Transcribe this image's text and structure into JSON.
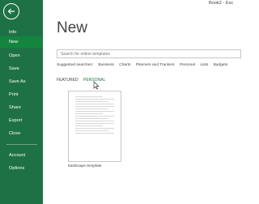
{
  "window": {
    "title": "Book2 - Exc"
  },
  "sidebar": {
    "items": [
      {
        "label": "Info"
      },
      {
        "label": "New"
      },
      {
        "label": "Open"
      },
      {
        "label": "Save"
      },
      {
        "label": "Save As"
      },
      {
        "label": "Print"
      },
      {
        "label": "Share"
      },
      {
        "label": "Export"
      },
      {
        "label": "Close"
      },
      {
        "label": "Account"
      },
      {
        "label": "Options"
      }
    ],
    "colors": {
      "background": "#1e7145",
      "active": "#13853f"
    }
  },
  "main": {
    "title": "New",
    "search": {
      "placeholder": "Search for online templates"
    },
    "suggested": {
      "label": "Suggested searches:",
      "items": [
        "Business",
        "Charts",
        "Planners and Trackers",
        "Personal",
        "Lists",
        "Budgets"
      ]
    },
    "tabs": [
      {
        "label": "FEATURED"
      },
      {
        "label": "PERSONAL"
      }
    ],
    "templates": [
      {
        "name": "landscape template"
      }
    ],
    "accent_color": "#217346"
  }
}
